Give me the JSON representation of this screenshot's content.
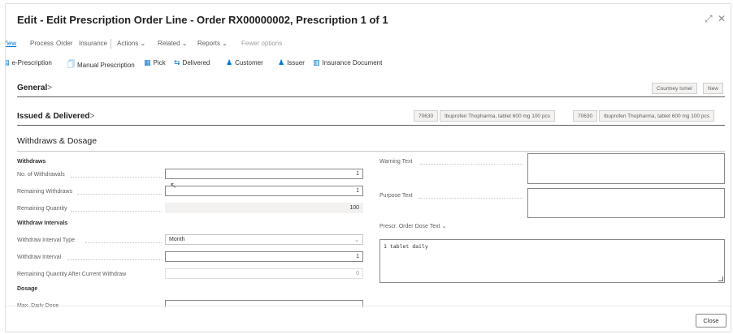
{
  "window": {
    "title": "Edit - Edit Prescription Order Line - Order RX00000002, Prescription 1 of 1",
    "expand_icon": "⤢",
    "close_icon": "✕"
  },
  "action_bar": {
    "view": "View",
    "process": "Process",
    "order": "Order",
    "insurance": "Insurance",
    "actions": "Actions ⌄",
    "related": "Related ⌄",
    "reports": "Reports ⌄",
    "fewer_options": "Fewer options"
  },
  "toolbar": {
    "e_prescription": "e-Prescription",
    "manual_prescription": "Manual Prescription",
    "pick": "Pick",
    "delivered": "Delivered",
    "customer": "Customer",
    "issuer": "Issuer",
    "insurance_document": "Insurance Document"
  },
  "general": {
    "heading": "General",
    "chevron": ">",
    "pill1": "Courtney Ismel",
    "pill2": "New"
  },
  "issued": {
    "heading": "Issued & Delivered",
    "chevron": ">",
    "pill1": "70630",
    "pill2": "Ibuprofen Thopharma, tablet 600 mg 100 pcs",
    "pill3": "70630",
    "pill4": "Ibuprofen Thopharma, tablet 600 mg 100 pcs"
  },
  "withdraws": {
    "heading": "Withdraws & Dosage",
    "withdraws_group": "Withdraws",
    "no_withdrawals_label": "No. of Withdrawals",
    "no_withdrawals_value": "1",
    "remaining_withdraws_label": "Remaining Withdraws",
    "remaining_withdraws_value": "1",
    "remaining_quantity_label": "Remaining Quantity",
    "remaining_quantity_value": "100",
    "intervals_group": "Withdraw Intervals",
    "interval_type_label": "Withdraw Interval Type",
    "interval_type_value": "Month",
    "interval_label": "Withdraw Interval",
    "interval_value": "1",
    "remaining_after_label": "Remaining Quantity After Current Withdraw",
    "remaining_after_value": "0",
    "dosage_group": "Dosage",
    "max_daily_dose_label": "Max. Daily Dose",
    "warning_text_label": "Warning Text",
    "purpose_text_label": "Purpose Text",
    "dose_text_label": "Prescr. Order Dose Text ⌄",
    "dose_text_value": "1 tablet daily"
  },
  "footer": {
    "close": "Close"
  }
}
